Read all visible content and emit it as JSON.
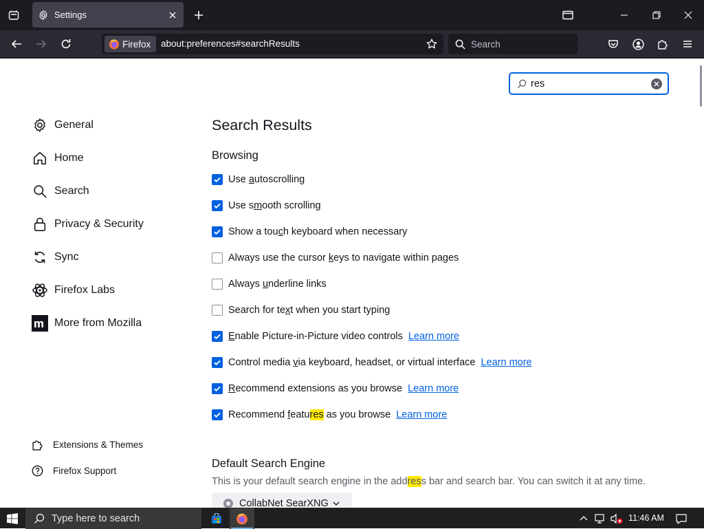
{
  "window": {
    "tab_title": "Settings"
  },
  "navbar": {
    "identity_label": "Firefox",
    "url": "about:preferences#searchResults",
    "search_placeholder": "Search"
  },
  "find": {
    "value": "res"
  },
  "sidebar": {
    "items": [
      {
        "label": "General",
        "icon": "gear-icon"
      },
      {
        "label": "Home",
        "icon": "home-icon"
      },
      {
        "label": "Search",
        "icon": "search-icon"
      },
      {
        "label": "Privacy & Security",
        "icon": "lock-icon"
      },
      {
        "label": "Sync",
        "icon": "sync-icon"
      },
      {
        "label": "Firefox Labs",
        "icon": "labs-icon"
      },
      {
        "label": "More from Mozilla",
        "icon": "mozilla-m-icon"
      }
    ],
    "footer": [
      {
        "label": "Extensions & Themes",
        "icon": "puzzle-icon"
      },
      {
        "label": "Firefox Support",
        "icon": "help-icon"
      }
    ]
  },
  "main": {
    "title": "Search Results",
    "browsing": {
      "heading": "Browsing",
      "options": [
        {
          "pre": "Use ",
          "u": "a",
          "post": "utoscrolling",
          "checked": true
        },
        {
          "pre": "Use s",
          "u": "m",
          "post": "ooth scrolling",
          "checked": true
        },
        {
          "pre": "Show a tou",
          "u": "c",
          "post": "h keyboard when necessary",
          "checked": true
        },
        {
          "pre": "Always use the cursor ",
          "u": "k",
          "post": "eys to navigate within pages",
          "checked": false
        },
        {
          "pre": "Always ",
          "u": "u",
          "post": "nderline links",
          "checked": false
        },
        {
          "pre": "Search for te",
          "u": "x",
          "post": "t when you start typing",
          "checked": false
        },
        {
          "pre": "",
          "u": "E",
          "post": "nable Picture-in-Picture video controls",
          "checked": true,
          "link": "Learn more"
        },
        {
          "pre": "Control media ",
          "u": "v",
          "post": "ia keyboard, headset, or virtual interface",
          "checked": true,
          "link": "Learn more"
        },
        {
          "pre": "",
          "u": "R",
          "post": "ecommend extensions as you browse",
          "checked": true,
          "link": "Learn more"
        },
        {
          "pre": "Recommend ",
          "u": "f",
          "post": "eatu",
          "hl": "res",
          "post2": " as you browse",
          "checked": true,
          "link": "Learn more"
        }
      ]
    },
    "default_engine": {
      "heading": "Default Search Engine",
      "desc_pre": "This is your default search engine in the add",
      "desc_hl": "res",
      "desc_post": "s bar and search bar. You can switch it at any time.",
      "engine": "CollabNet SearXNG"
    }
  },
  "taskbar": {
    "search_placeholder": "Type here to search",
    "time": "11:46 AM"
  },
  "colors": {
    "accent": "#0061e0",
    "highlight": "#ffe900"
  }
}
